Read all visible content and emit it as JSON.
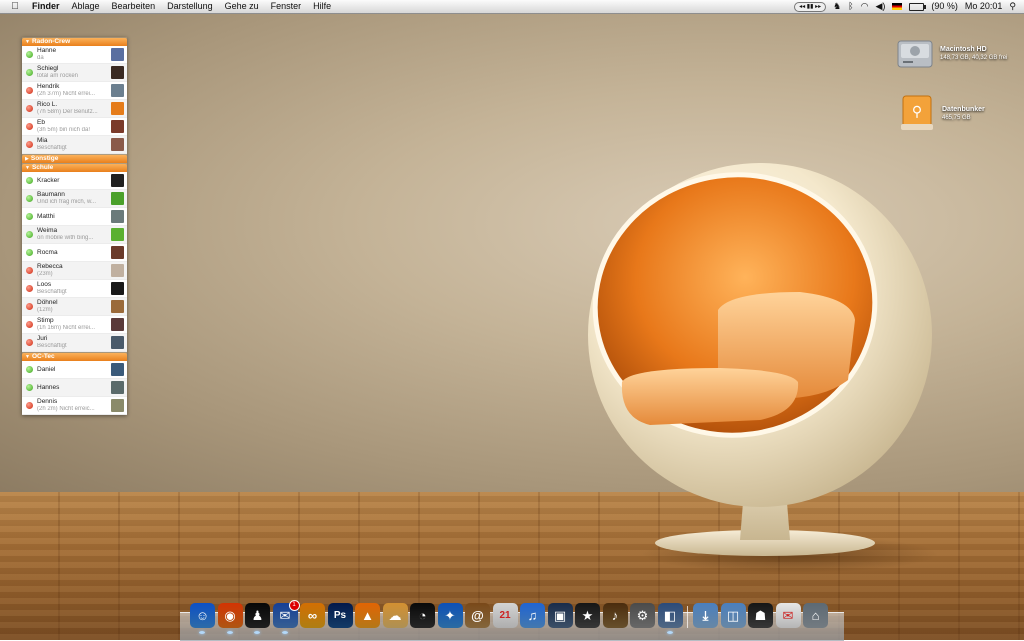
{
  "menubar": {
    "app_name": "Finder",
    "items": [
      "Ablage",
      "Bearbeiten",
      "Darstellung",
      "Gehe zu",
      "Fenster",
      "Hilfe"
    ],
    "media_controls": "◂◂ ▮▮ ▸▸",
    "battery": "(90 %)",
    "clock": "Mo 20:01"
  },
  "contacts": {
    "groups": [
      {
        "name": "Radon-Crew",
        "contacts": [
          {
            "name": "Hanne",
            "status": "da",
            "online": true,
            "avatar_color": "#5a6fa0"
          },
          {
            "name": "Schiegl",
            "status": "total am rocken",
            "online": true,
            "avatar_color": "#3a2a22"
          },
          {
            "name": "Hendrik",
            "status": "(2h 37m) Nicht errei...",
            "online": false,
            "avatar_color": "#6b7f8f"
          },
          {
            "name": "Rico L.",
            "status": "(7h 58m) Der Benutz...",
            "online": false,
            "avatar_color": "#e57c1a"
          },
          {
            "name": "Eb",
            "status": "(3h 5m) bin nich da!",
            "online": false,
            "avatar_color": "#7a3a2a"
          },
          {
            "name": "Mia",
            "status": "Beschäftigt",
            "online": false,
            "avatar_color": "#8a5a4a"
          }
        ]
      },
      {
        "name": "Sonstige",
        "collapsed": true,
        "contacts": []
      },
      {
        "name": "Schule",
        "contacts": [
          {
            "name": "Kracker",
            "status": "",
            "online": true,
            "avatar_color": "#202020"
          },
          {
            "name": "Baumann",
            "status": "Und ich frag mich, w...",
            "online": true,
            "avatar_color": "#4aa02a"
          },
          {
            "name": "Matthi",
            "status": "",
            "online": true,
            "avatar_color": "#6a7a7a"
          },
          {
            "name": "Weima",
            "status": "on mobile with bing...",
            "online": true,
            "avatar_color": "#5ab030"
          },
          {
            "name": "Rocma",
            "status": "",
            "online": true,
            "avatar_color": "#6a3a2a"
          },
          {
            "name": "Rebecca",
            "status": "(23m)",
            "online": false,
            "avatar_color": "#c0b0a0"
          },
          {
            "name": "Loos",
            "status": "Beschäftigt",
            "online": false,
            "avatar_color": "#181818"
          },
          {
            "name": "Döhnel",
            "status": "(12m)",
            "online": false,
            "avatar_color": "#9a6a3a"
          },
          {
            "name": "Stimp",
            "status": "(1h 16m) Nicht errei...",
            "online": false,
            "avatar_color": "#5a3a3a"
          },
          {
            "name": "Juri",
            "status": "Beschäftigt",
            "online": false,
            "avatar_color": "#4a5a6a"
          }
        ]
      },
      {
        "name": "OC-Tec",
        "contacts": [
          {
            "name": "Daniel",
            "status": "",
            "online": true,
            "avatar_color": "#3a5a7a"
          },
          {
            "name": "Hannes",
            "status": "",
            "online": true,
            "avatar_color": "#5a6a6a"
          },
          {
            "name": "Dennis",
            "status": "(2h 2m) Nicht erreic...",
            "online": false,
            "avatar_color": "#8a8a6a"
          }
        ]
      }
    ]
  },
  "desktop_icons": {
    "hd": {
      "label": "Macintosh HD",
      "info": "148,73 GB, 40,32 GB frei"
    },
    "usb": {
      "label": "Datenbunker",
      "info": "465,75 GB"
    }
  },
  "dock": {
    "items": [
      {
        "name": "finder",
        "color": "#3b8fe0",
        "glyph": "☺",
        "running": true
      },
      {
        "name": "firefox",
        "color": "#e8731a",
        "glyph": "◉",
        "running": true
      },
      {
        "name": "adium",
        "color": "#2a2a2a",
        "glyph": "♟",
        "running": true
      },
      {
        "name": "mail",
        "color": "#4a7fc4",
        "glyph": "✉",
        "running": true,
        "badge": "1"
      },
      {
        "name": "bridge",
        "color": "#e8a81a",
        "glyph": "∞",
        "running": false
      },
      {
        "name": "photoshop",
        "color": "#1a4f8a",
        "glyph": "Ps",
        "running": false
      },
      {
        "name": "vlc",
        "color": "#f0a020",
        "glyph": "▲",
        "running": false
      },
      {
        "name": "toast",
        "color": "#e8c070",
        "glyph": "☁",
        "running": false
      },
      {
        "name": "dashboard",
        "color": "#333333",
        "glyph": "◔",
        "running": false
      },
      {
        "name": "safari",
        "color": "#3a8fd8",
        "glyph": "✦",
        "running": false
      },
      {
        "name": "address-book",
        "color": "#b08850",
        "glyph": "@",
        "running": false
      },
      {
        "name": "ical",
        "color": "#e8e8e8",
        "glyph": "21",
        "running": false
      },
      {
        "name": "itunes",
        "color": "#5aa0e8",
        "glyph": "♫",
        "running": false
      },
      {
        "name": "iphoto",
        "color": "#506a8a",
        "glyph": "▣",
        "running": false
      },
      {
        "name": "imovie",
        "color": "#4a4a4a",
        "glyph": "★",
        "running": false
      },
      {
        "name": "garageband",
        "color": "#8a6a3a",
        "glyph": "♪",
        "running": false
      },
      {
        "name": "system-preferences",
        "color": "#8a8a8a",
        "glyph": "⚙",
        "running": false
      },
      {
        "name": "preview",
        "color": "#6a8ab0",
        "glyph": "◧",
        "running": true
      },
      {
        "name": "downloads-folder",
        "color": "#8ab4dc",
        "glyph": "⤓",
        "running": false
      },
      {
        "name": "documents-folder",
        "color": "#8ab4dc",
        "glyph": "◫",
        "running": false
      },
      {
        "name": "user-folder",
        "color": "#4a4a4a",
        "glyph": "☗",
        "running": false
      },
      {
        "name": "apps-stack",
        "color": "#f2f2f2",
        "glyph": "✉",
        "running": false
      },
      {
        "name": "trash",
        "color": "#9aa4ac",
        "glyph": "⌂",
        "running": false
      }
    ]
  }
}
